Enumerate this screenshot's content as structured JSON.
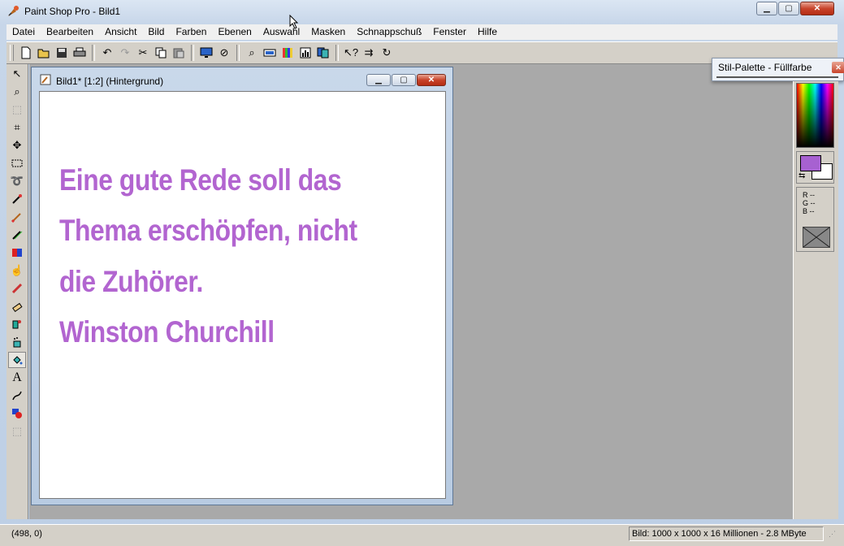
{
  "app": {
    "title": "Paint Shop Pro - Bild1"
  },
  "menu": [
    "Datei",
    "Bearbeiten",
    "Ansicht",
    "Bild",
    "Farben",
    "Ebenen",
    "Auswahl",
    "Masken",
    "Schnappschuß",
    "Fenster",
    "Hilfe"
  ],
  "toolbar": {
    "icons": [
      "new-file-icon",
      "open-folder-icon",
      "save-icon",
      "print-icon",
      "undo-icon",
      "redo-icon",
      "cut-icon",
      "copy-icon",
      "paste-icon",
      "full-screen-preview-icon",
      "cancel-icon",
      "zoom-icon",
      "toolbar-toggle-icon",
      "color-palette-icon",
      "histogram-icon",
      "layer-icon",
      "help-pointer-icon",
      "arrange-icon",
      "refresh-icon"
    ]
  },
  "tools": [
    "arrow-icon",
    "zoom-icon",
    "deform-icon",
    "crop-icon",
    "mover-icon",
    "selection-icon",
    "freehand-icon",
    "dropper-icon",
    "paintbrush-icon",
    "clone-brush-icon",
    "color-replacer-icon",
    "retouch-icon",
    "scratch-remover-icon",
    "eraser-icon",
    "picture-tube-icon",
    "airbrush-icon",
    "flood-fill-icon",
    "text-icon",
    "line-icon",
    "shapes-icon",
    "vector-icon"
  ],
  "document": {
    "title": "Bild1* [1:2] (Hintergrund)",
    "text_color": "#b265d0",
    "lines": [
      "Eine gute Rede soll das",
      "Thema erschöpfen, nicht",
      "die Zuhörer.",
      "Winston Churchill"
    ]
  },
  "style_palette": {
    "title": "Stil-Palette - Füllfarbe",
    "foreground_color": "#a761d1",
    "background_color": "#ffffff",
    "rgb_readout": "R --\nG --\nB --"
  },
  "status": {
    "coords": "(498, 0)",
    "info": "Bild:  1000 x 1000 x 16 Millionen - 2.8 MByte"
  }
}
